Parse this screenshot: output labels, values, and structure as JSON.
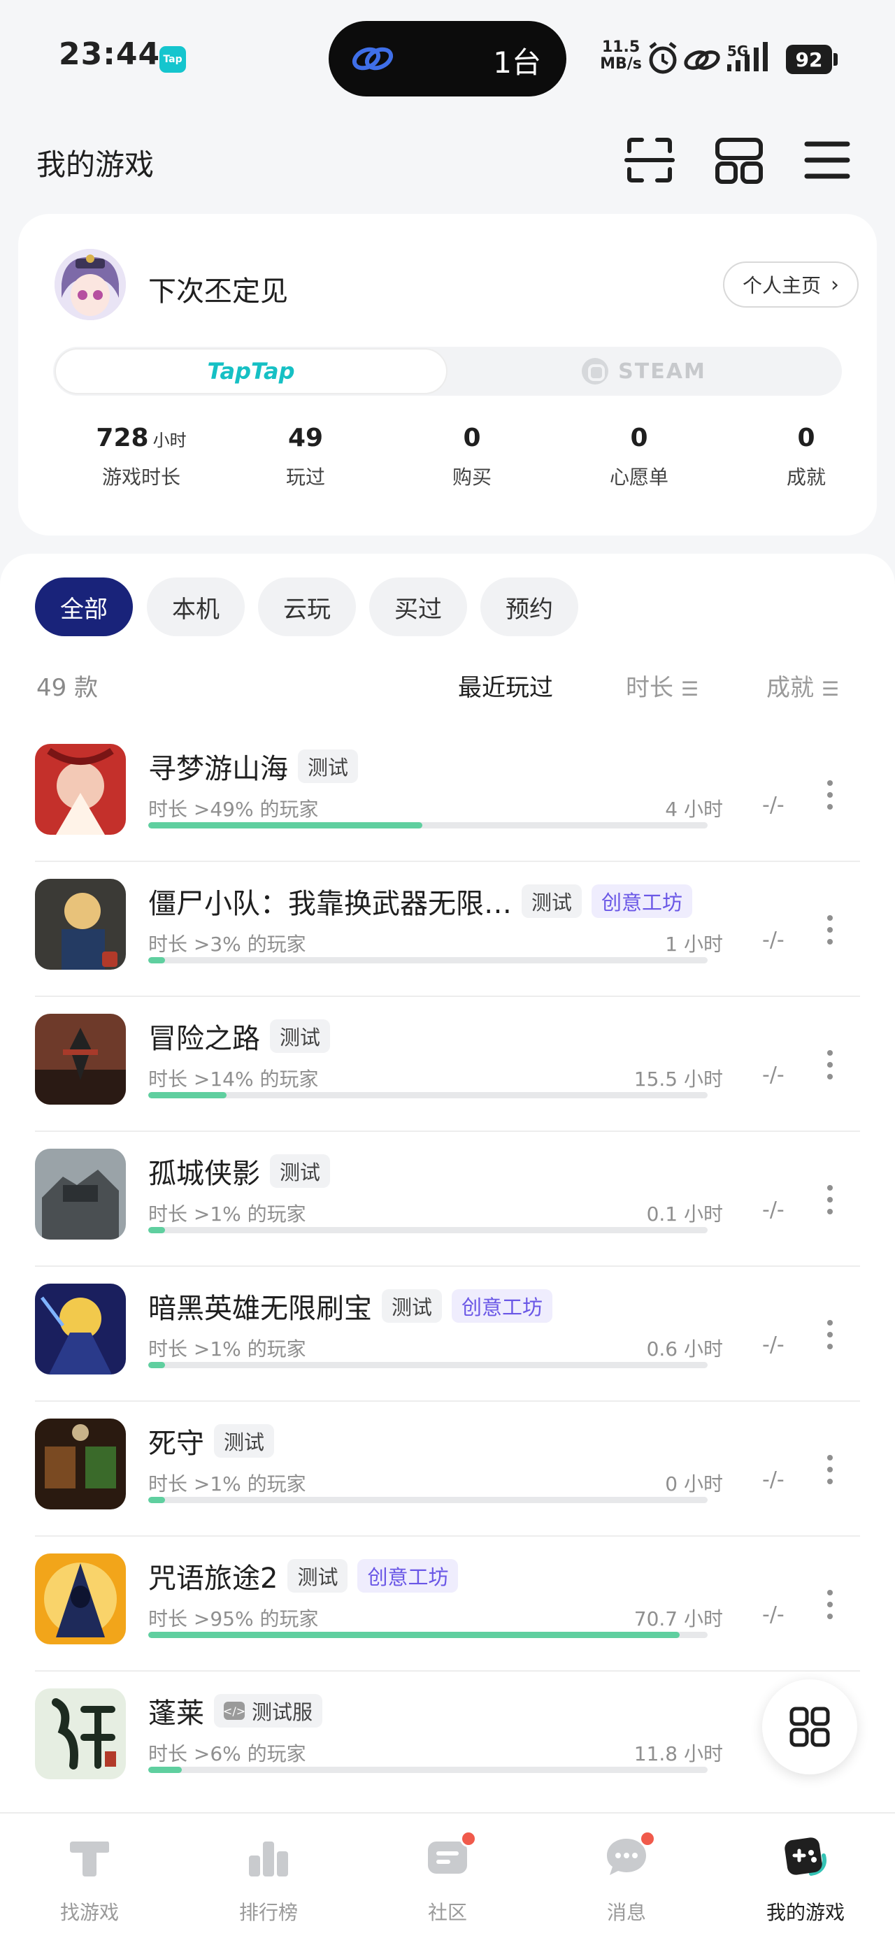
{
  "status_bar": {
    "time": "23:44",
    "app_badge": "Tap",
    "island_text": "1台",
    "net_speed_value": "11.5",
    "net_speed_unit": "MB/s",
    "signal": "5G",
    "battery": "92"
  },
  "header": {
    "title": "我的游戏",
    "icons": [
      "scan-icon",
      "layout-grid-icon",
      "menu-icon"
    ]
  },
  "profile": {
    "username": "下次丕定见",
    "homepage_label": "个人主页",
    "platforms": [
      "TapTap",
      "STEAM"
    ],
    "active_platform": "TapTap",
    "stats": [
      {
        "value": "728",
        "unit": "小时",
        "label": "游戏时长"
      },
      {
        "value": "49",
        "unit": "",
        "label": "玩过"
      },
      {
        "value": "0",
        "unit": "",
        "label": "购买"
      },
      {
        "value": "0",
        "unit": "",
        "label": "心愿单"
      },
      {
        "value": "0",
        "unit": "",
        "label": "成就"
      }
    ]
  },
  "filters": {
    "chips": [
      "全部",
      "本机",
      "云玩",
      "买过",
      "预约"
    ],
    "active": "全部"
  },
  "list_header": {
    "count": "49 款",
    "sort_recent": "最近玩过",
    "sort_duration": "时长",
    "sort_achievement": "成就"
  },
  "games": [
    {
      "name": "寻梦游山海",
      "tags": [
        "测试"
      ],
      "subtitle": "时长 >49% 的玩家",
      "hours": "4 小时",
      "progress": 0.49,
      "achievement": "-/-"
    },
    {
      "name": "僵尸小队：我靠换武器无限…",
      "tags": [
        "测试",
        "创意工坊"
      ],
      "subtitle": "时长 >3% 的玩家",
      "hours": "1 小时",
      "progress": 0.03,
      "achievement": "-/-"
    },
    {
      "name": "冒险之路",
      "tags": [
        "测试"
      ],
      "subtitle": "时长 >14% 的玩家",
      "hours": "15.5 小时",
      "progress": 0.14,
      "achievement": "-/-"
    },
    {
      "name": "孤城侠影",
      "tags": [
        "测试"
      ],
      "subtitle": "时长 >1% 的玩家",
      "hours": "0.1 小时",
      "progress": 0.01,
      "achievement": "-/-"
    },
    {
      "name": "暗黑英雄无限刷宝",
      "tags": [
        "测试",
        "创意工坊"
      ],
      "subtitle": "时长 >1% 的玩家",
      "hours": "0.6 小时",
      "progress": 0.01,
      "achievement": "-/-"
    },
    {
      "name": "死守",
      "tags": [
        "测试"
      ],
      "subtitle": "时长 >1% 的玩家",
      "hours": "0 小时",
      "progress": 0.01,
      "achievement": "-/-"
    },
    {
      "name": "咒语旅途2",
      "tags": [
        "测试",
        "创意工坊"
      ],
      "subtitle": "时长 >95% 的玩家",
      "hours": "70.7 小时",
      "progress": 0.95,
      "achievement": "-/-"
    },
    {
      "name": "蓬莱",
      "tags": [
        "测试服"
      ],
      "subtitle": "时长 >6% 的玩家",
      "hours": "11.8 小时",
      "progress": 0.06,
      "achievement": ""
    }
  ],
  "bottom_nav": [
    {
      "label": "找游戏",
      "icon": "tap-logo-icon",
      "badge": false
    },
    {
      "label": "排行榜",
      "icon": "ranking-icon",
      "badge": false
    },
    {
      "label": "社区",
      "icon": "community-icon",
      "badge": true
    },
    {
      "label": "消息",
      "icon": "message-icon",
      "badge": true
    },
    {
      "label": "我的游戏",
      "icon": "gamepad-icon",
      "badge": false
    }
  ],
  "colors": {
    "accent_chip": "#19237a",
    "progress": "#5fcf9f",
    "taptap": "#16c0c4",
    "workshop": "#6a57e6",
    "badge": "#f05a4b"
  }
}
